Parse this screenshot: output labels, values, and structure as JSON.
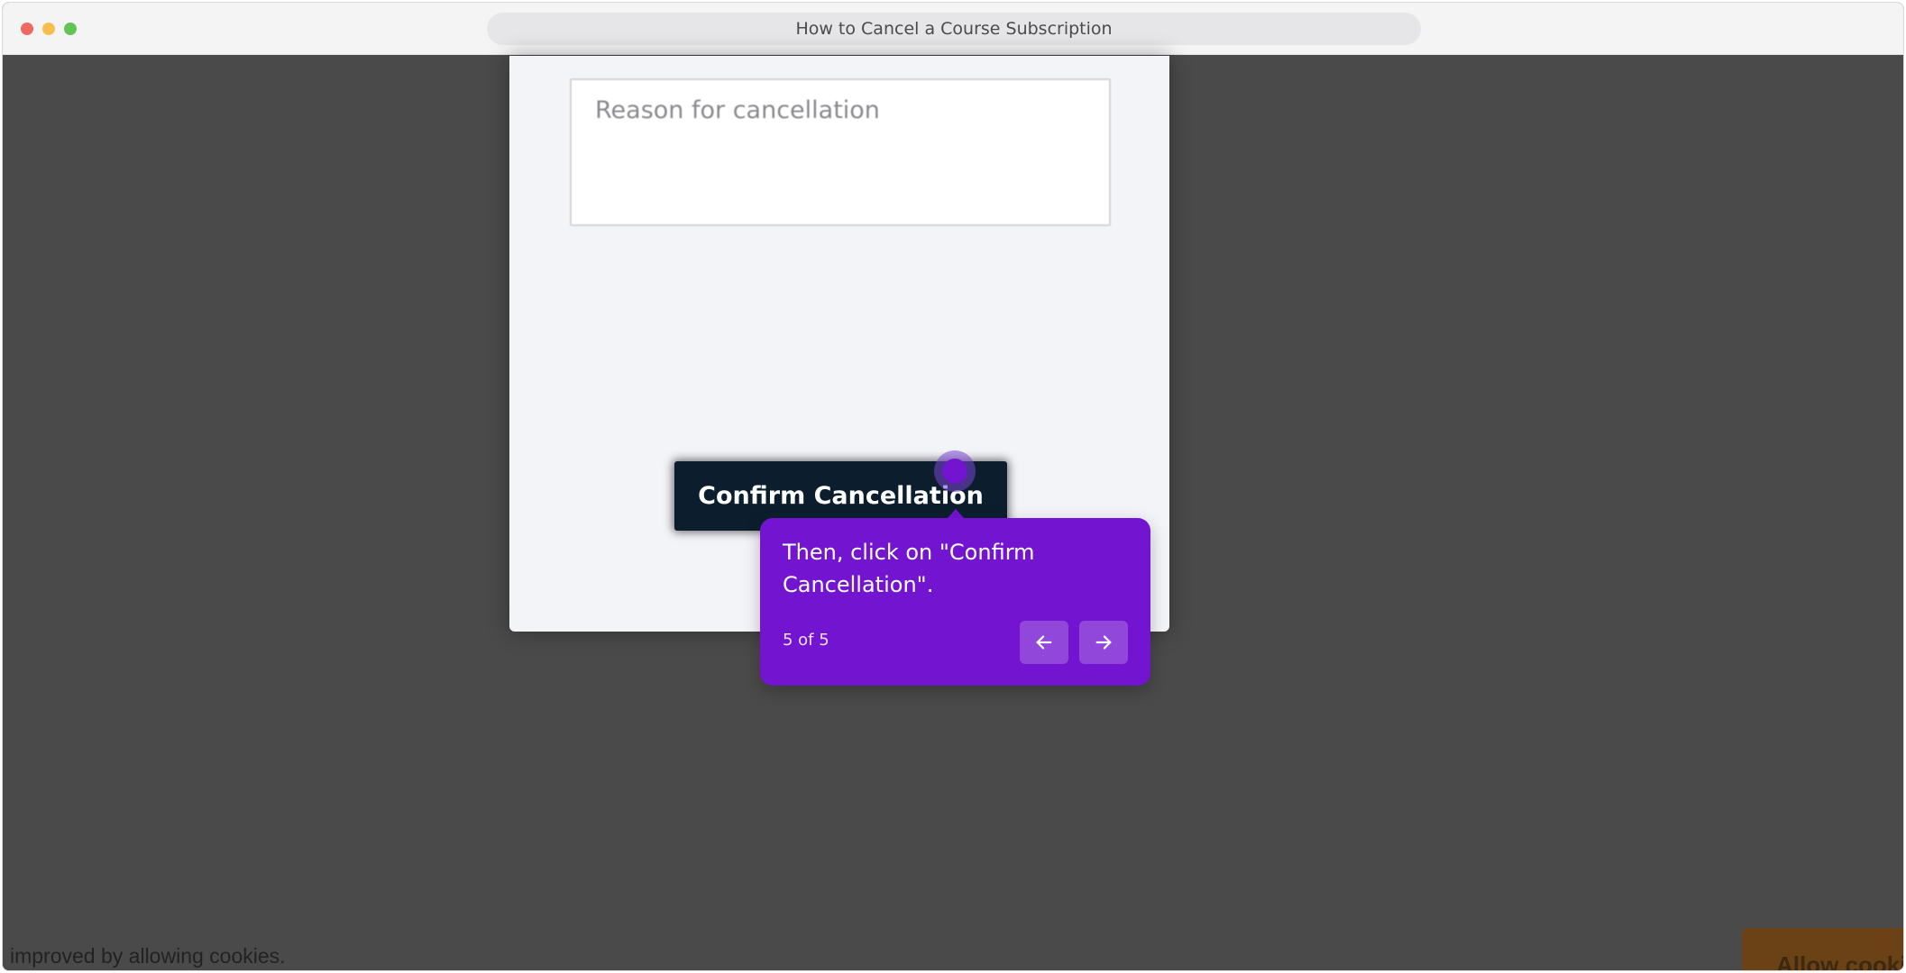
{
  "window": {
    "title": "How to Cancel a Course Subscription"
  },
  "form": {
    "reason_placeholder": "Reason for cancellation",
    "confirm_label": "Confirm Cancellation"
  },
  "tour": {
    "text": "Then, click on \"Confirm Cancellation\".",
    "step": "5 of 5",
    "prev_icon": "arrow-left-icon",
    "next_icon": "arrow-right-icon",
    "accent_color": "#7314d0"
  },
  "cookie_banner": {
    "text": "improved by allowing cookies.",
    "button_label": "Allow cookies"
  },
  "colors": {
    "overlay": "#4a4a4a",
    "button_dark": "#0c1e2e"
  }
}
